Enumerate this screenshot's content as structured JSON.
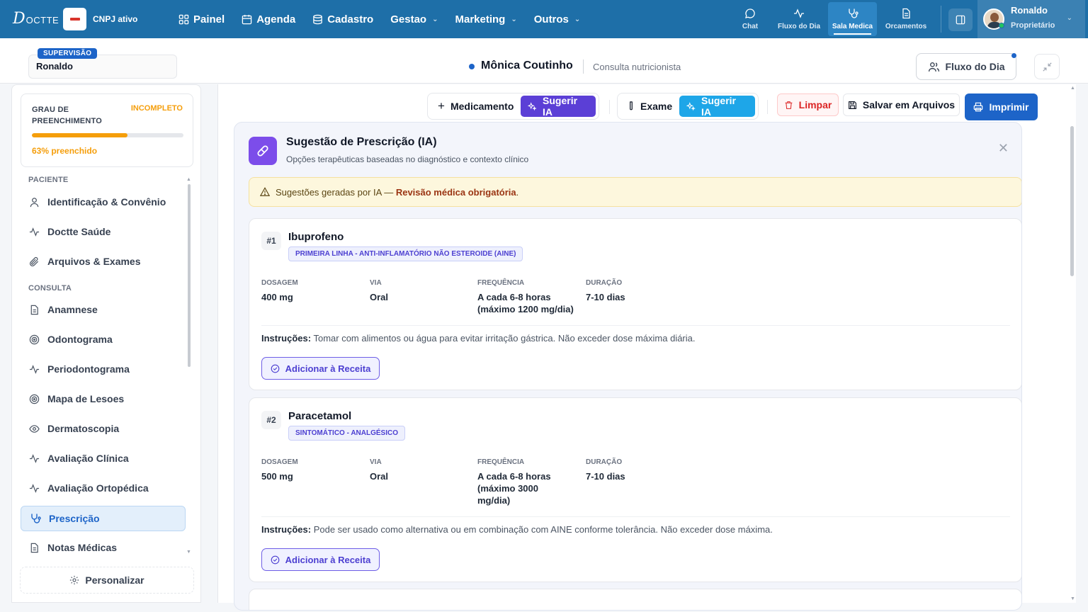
{
  "brand": {
    "logo_initial": "D",
    "logo_rest": "OCTTE",
    "cnpj_label": "CNPJ ativo"
  },
  "nav": [
    {
      "label": "Painel",
      "icon": "grid-icon",
      "dropdown": false
    },
    {
      "label": "Agenda",
      "icon": "calendar-icon",
      "dropdown": false
    },
    {
      "label": "Cadastro",
      "icon": "database-icon",
      "dropdown": false
    },
    {
      "label": "Gestao",
      "icon": "",
      "dropdown": true
    },
    {
      "label": "Marketing",
      "icon": "",
      "dropdown": true
    },
    {
      "label": "Outros",
      "icon": "",
      "dropdown": true
    }
  ],
  "quick": [
    {
      "label": "Chat",
      "icon": "chat-icon",
      "active": false
    },
    {
      "label": "Fluxo do Dia",
      "icon": "activity-icon",
      "active": false
    },
    {
      "label": "Sala Medica",
      "icon": "stethoscope-icon",
      "active": true
    },
    {
      "label": "Orcamentos",
      "icon": "document-icon",
      "active": false
    }
  ],
  "user": {
    "name": "Ronaldo",
    "role": "Proprietário"
  },
  "supervision": {
    "badge": "SUPERVISÃO",
    "name": "Ronaldo"
  },
  "patient": {
    "name": "Mônica Coutinho",
    "consult_type": "Consulta nutricionista"
  },
  "header_actions": {
    "fluxo_label": "Fluxo do Dia"
  },
  "completion": {
    "title": "GRAU DE PREENCHIMENTO",
    "status": "INCOMPLETO",
    "percent": 63,
    "percent_label": "63% preenchido"
  },
  "sidebar": {
    "sections": [
      {
        "label": "PACIENTE",
        "items": [
          {
            "label": "Identificação & Convênio",
            "icon": "user-icon"
          },
          {
            "label": "Doctte Saúde",
            "icon": "activity-icon"
          },
          {
            "label": "Arquivos & Exames",
            "icon": "paperclip-icon"
          }
        ]
      },
      {
        "label": "CONSULTA",
        "items": [
          {
            "label": "Anamnese",
            "icon": "document-icon"
          },
          {
            "label": "Odontograma",
            "icon": "target-icon"
          },
          {
            "label": "Periodontograma",
            "icon": "activity-icon"
          },
          {
            "label": "Mapa de Lesoes",
            "icon": "target-icon"
          },
          {
            "label": "Dermatoscopia",
            "icon": "eye-icon"
          },
          {
            "label": "Avaliação Clínica",
            "icon": "activity-icon"
          },
          {
            "label": "Avaliação Ortopédica",
            "icon": "activity-icon"
          },
          {
            "label": "Prescrição",
            "icon": "stethoscope-icon",
            "active": true
          },
          {
            "label": "Notas Médicas",
            "icon": "document-icon"
          }
        ]
      }
    ],
    "personalize_label": "Personalizar"
  },
  "toolbar": {
    "medicamento_label": "Medicamento",
    "sugerir_ia_label": "Sugerir IA",
    "exame_label": "Exame",
    "limpar_label": "Limpar",
    "salvar_label": "Salvar em Arquivos",
    "imprimir_label": "Imprimir"
  },
  "ai_panel": {
    "title": "Sugestão de Prescrição (IA)",
    "subtitle": "Opções terapêuticas baseadas no diagnóstico e contexto clínico",
    "warning_prefix": "Sugestões geradas por IA — ",
    "warning_bold": "Revisão médica obrigatória",
    "warning_suffix": "."
  },
  "field_labels": {
    "dosagem": "DOSAGEM",
    "via": "VIA",
    "frequencia": "FREQUÊNCIA",
    "duracao": "DURAÇÃO",
    "instrucoes": "Instruções:",
    "add": "Adicionar à Receita"
  },
  "medications": [
    {
      "num": "#1",
      "name": "Ibuprofeno",
      "tag": "PRIMEIRA LINHA - ANTI-INFLAMATÓRIO NÃO ESTEROIDE (AINE)",
      "dosagem": "400 mg",
      "via": "Oral",
      "frequencia": "A cada 6-8 horas (máximo 1200 mg/dia)",
      "duracao": "7-10 dias",
      "instrucoes": "Tomar com alimentos ou água para evitar irritação gástrica. Não exceder dose máxima diária."
    },
    {
      "num": "#2",
      "name": "Paracetamol",
      "tag": "SINTOMÁTICO - ANALGÉSICO",
      "dosagem": "500 mg",
      "via": "Oral",
      "frequencia": "A cada 6-8 horas (máximo 3000 mg/dia)",
      "duracao": "7-10 dias",
      "instrucoes": "Pode ser usado como alternativa ou em combinação com AINE conforme tolerância. Não exceder dose máxima."
    }
  ]
}
